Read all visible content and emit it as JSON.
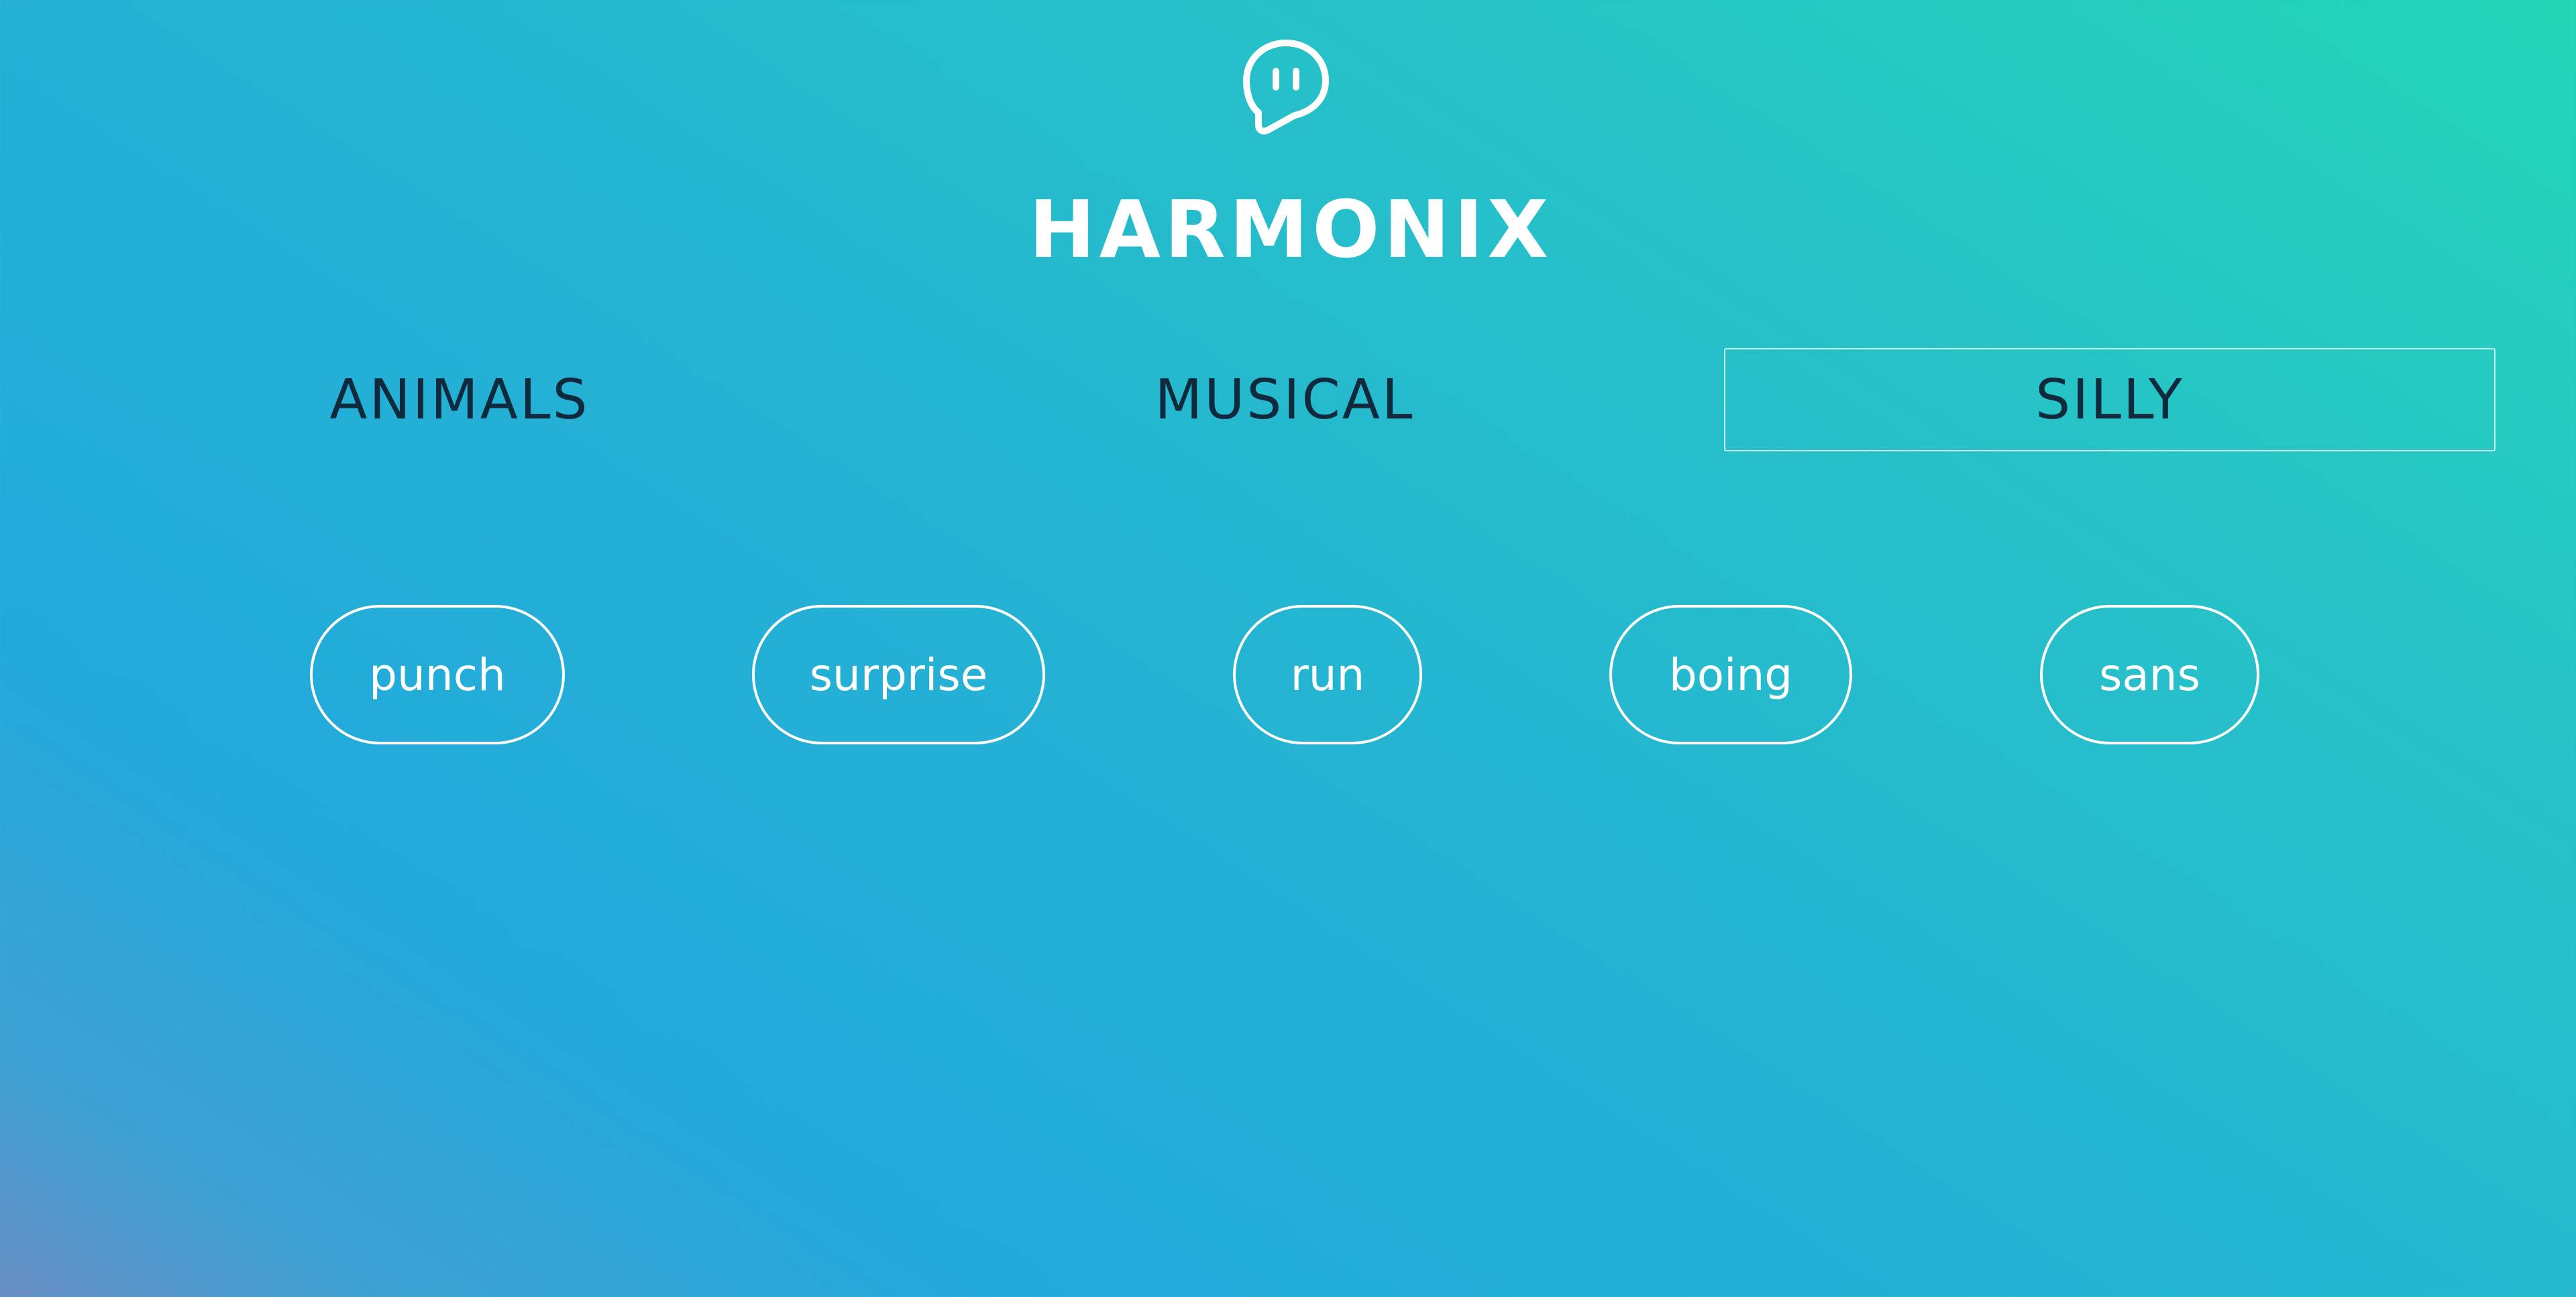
{
  "app": {
    "title": "HARMONIX",
    "logo_icon": "speech-bubble-face-icon"
  },
  "tabs": [
    {
      "label": "ANIMALS",
      "active": false
    },
    {
      "label": "MUSICAL",
      "active": false
    },
    {
      "label": "SILLY",
      "active": true
    }
  ],
  "sounds": [
    {
      "label": "punch"
    },
    {
      "label": "surprise"
    },
    {
      "label": "run"
    },
    {
      "label": "boing"
    },
    {
      "label": "sans"
    }
  ],
  "colors": {
    "text_light": "#ffffff",
    "tab_text": "#0f2a3c",
    "gradient_start": "#22a9db",
    "gradient_end": "#24d6b6"
  }
}
